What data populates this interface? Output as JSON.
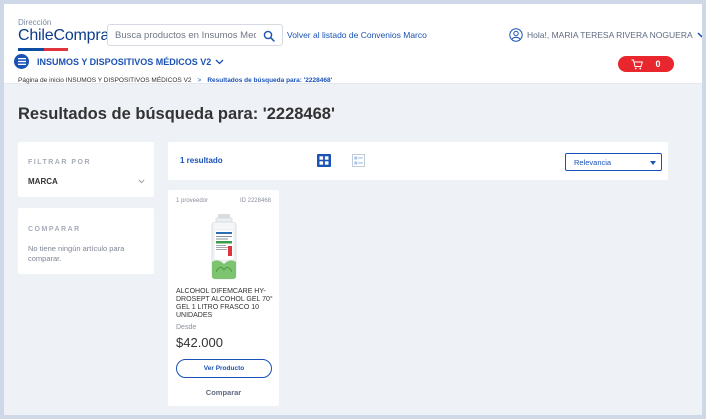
{
  "header": {
    "logo_small": "Dirección",
    "logo_big": "ChileCompra",
    "search_placeholder": "Busca productos en Insumos Medicos",
    "convenios_link": "Volver al listado de Convenios Marco",
    "user_greeting": "Hola!, MARIA TERESA RIVERA NOGUERA",
    "category": "INSUMOS Y DISPOSITIVOS MÉDICOS V2",
    "cart_count": "0"
  },
  "breadcrumb": {
    "home": "Página de inicio INSUMOS Y DISPOSITIVOS MÉDICOS V2",
    "separator": ">",
    "current": "Resultados de búsqueda para: '2228468'"
  },
  "page_title": "Resultados de búsqueda para: '2228468'",
  "sidebar": {
    "filter_heading": "FILTRAR POR",
    "filter_marca": "MARCA",
    "compare_heading": "COMPARAR",
    "compare_text": "No tiene ningún artículo para comparar."
  },
  "toolbar": {
    "result_count": "1 resultado",
    "sort_value": "Relevancia"
  },
  "product": {
    "provider": "1 proveedor",
    "id": "ID 2228468",
    "name": "ALCOHOL DIFEMCARE HY-DROSEPT ALCOHOL GEL 70° GEL 1 LITRO FRASCO 10 UNIDADES",
    "from_label": "Desde",
    "price": "$42.000",
    "view_label": "Ver Producto",
    "compare_label": "Comparar"
  },
  "colors": {
    "brand_blue": "#1a52b5",
    "cart_red": "#e8262e",
    "page_bg": "#eef1f6"
  }
}
